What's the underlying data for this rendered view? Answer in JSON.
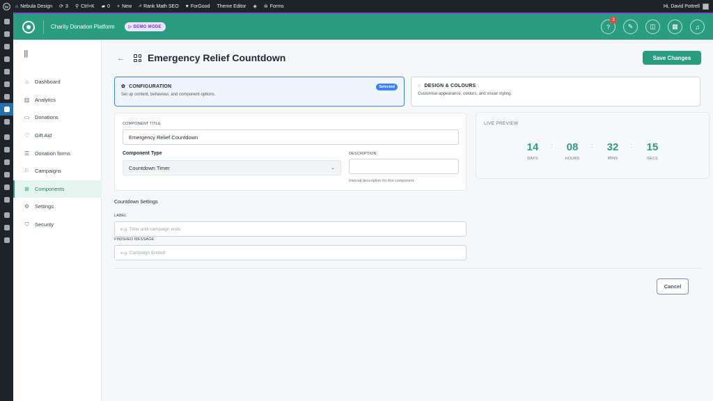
{
  "adminbar": {
    "site_name": "Nebula Design",
    "updates_count": "3",
    "shortcut": "Ctrl+K",
    "comments_count": "0",
    "new_label": "New",
    "rank_math": "Rank Math SEO",
    "forgood": "ForGood",
    "theme_editor": "Theme Editor",
    "forms": "Forms",
    "greeting": "Hi, David Pottrell"
  },
  "plugin": {
    "title": "Charity Donation Platform",
    "demo_badge": "DEMO MODE",
    "notification_count": "3"
  },
  "sidebar": {
    "items": [
      {
        "label": "Dashboard",
        "icon": "home-icon"
      },
      {
        "label": "Analytics",
        "icon": "chart-icon"
      },
      {
        "label": "Donations",
        "icon": "card-icon"
      },
      {
        "label": "Gift Aid",
        "icon": "heart-icon"
      },
      {
        "label": "Donation forms",
        "icon": "list-icon"
      },
      {
        "label": "Campaigns",
        "icon": "flag-icon"
      },
      {
        "label": "Components",
        "icon": "grid-icon",
        "active": true
      },
      {
        "label": "Settings",
        "icon": "gear-icon"
      },
      {
        "label": "Security",
        "icon": "shield-icon"
      }
    ]
  },
  "page": {
    "title": "Emergency Relief Countdown",
    "save_label": "Save Changes",
    "cancel_label": "Cancel"
  },
  "tabs": {
    "config": {
      "title": "CONFIGURATION",
      "desc": "Set up content, behaviour, and component options.",
      "badge": "Selected"
    },
    "design": {
      "title": "DESIGN & COLOURS",
      "desc": "Customise appearance, colours, and visual styling."
    }
  },
  "form": {
    "component_title_label": "COMPONENT TITLE",
    "component_title_value": "Emergency Relief Countdown",
    "component_type_label": "Component Type",
    "component_type_value": "Countdown Timer",
    "description_label": "DESCRIPTION",
    "description_value": "",
    "description_help": "Internal description for this component"
  },
  "countdown_settings": {
    "title": "Countdown Settings",
    "label_label": "LABEL",
    "label_placeholder": "e.g. Time until campaign ends",
    "finished_label": "FINISHED MESSAGE",
    "finished_placeholder": "e.g. Campaign Ended!"
  },
  "preview": {
    "title": "LIVE PREVIEW",
    "units": [
      {
        "value": "14",
        "label": "DAYS"
      },
      {
        "value": "08",
        "label": "HOURS"
      },
      {
        "value": "32",
        "label": "MINS"
      },
      {
        "value": "15",
        "label": "SECS"
      }
    ]
  },
  "colors": {
    "accent": "#2a9d80",
    "selected_border": "#3b82f6",
    "demo_badge": "#6d35d6"
  }
}
